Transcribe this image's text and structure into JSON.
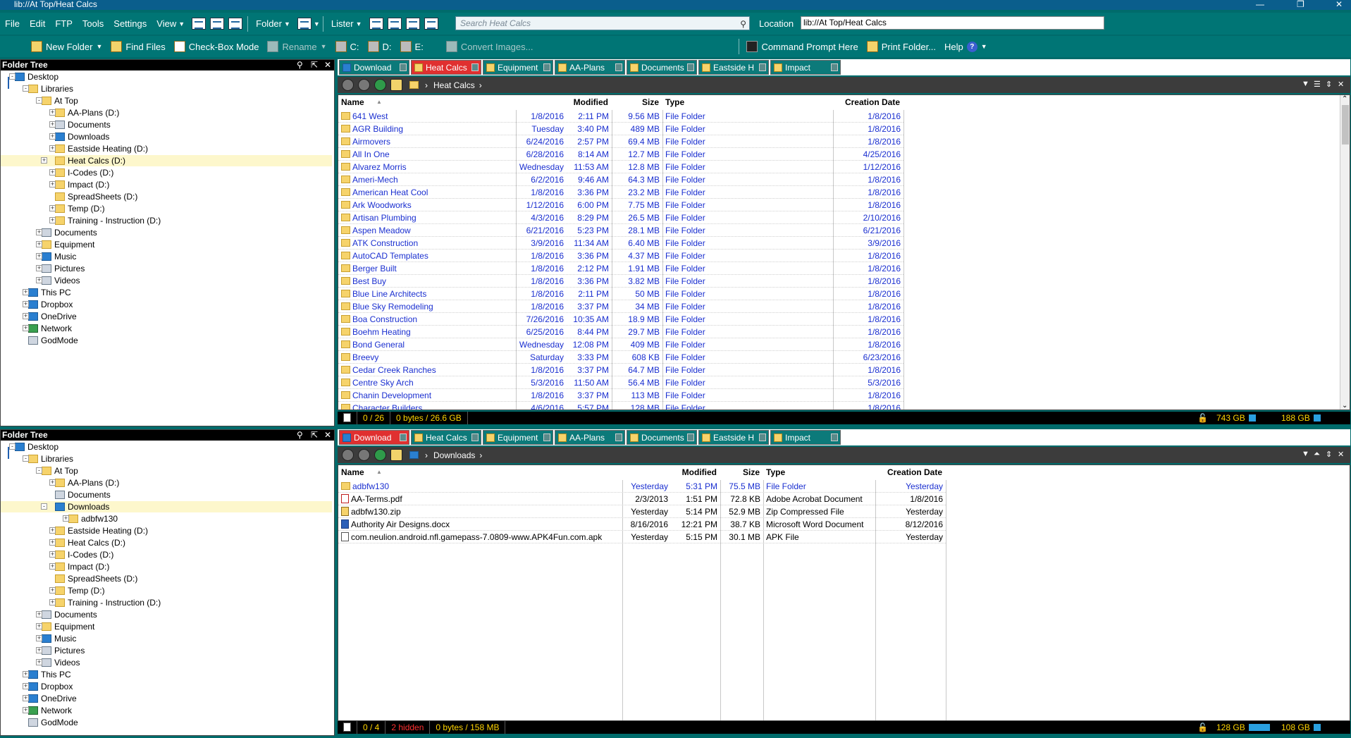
{
  "window": {
    "title": "lib://At Top/Heat Calcs"
  },
  "menu": {
    "file": "File",
    "edit": "Edit",
    "ftp": "FTP",
    "tools": "Tools",
    "settings": "Settings",
    "view": "View",
    "folder": "Folder",
    "lister": "Lister"
  },
  "search": {
    "placeholder": "Search Heat Calcs"
  },
  "location": {
    "label": "Location",
    "value": "lib://At Top/Heat Calcs"
  },
  "toolbar": {
    "new_folder": "New Folder",
    "find_files": "Find Files",
    "checkbox_mode": "Check-Box Mode",
    "rename": "Rename",
    "drive_c": "C:",
    "drive_d": "D:",
    "drive_e": "E:",
    "convert_images": "Convert Images...",
    "command_prompt": "Command Prompt Here",
    "print_folder": "Print Folder...",
    "help": "Help",
    "help_q": "?"
  },
  "top": {
    "tree": {
      "title": "Folder Tree",
      "nodes": [
        "Desktop",
        "Libraries",
        "At Top",
        "AA-Plans (D:)",
        "Documents",
        "Downloads",
        "Eastside Heating (D:)",
        "Heat Calcs (D:)",
        "I-Codes (D:)",
        "Impact (D:)",
        "SpreadSheets (D:)",
        "Temp (D:)",
        "Training - Instruction (D:)",
        "Documents",
        "Equipment",
        "Music",
        "Pictures",
        "Videos",
        "This PC",
        "Dropbox",
        "OneDrive",
        "Network",
        "GodMode"
      ]
    },
    "tabs": [
      "Download",
      "Heat Calcs",
      "Equipment",
      "AA-Plans",
      "Documents",
      "Eastside H",
      "Impact"
    ],
    "path": "Heat Calcs",
    "columns": {
      "name": "Name",
      "modified": "Modified",
      "size": "Size",
      "type": "Type",
      "created": "Creation Date"
    },
    "rows": [
      [
        "641 West",
        "1/8/2016",
        "2:11 PM",
        "9.56 MB",
        "File Folder",
        "1/8/2016"
      ],
      [
        "AGR Building",
        "Tuesday",
        "3:40 PM",
        "489 MB",
        "File Folder",
        "1/8/2016"
      ],
      [
        "Airmovers",
        "6/24/2016",
        "2:57 PM",
        "69.4 MB",
        "File Folder",
        "1/8/2016"
      ],
      [
        "All In One",
        "6/28/2016",
        "8:14 AM",
        "12.7 MB",
        "File Folder",
        "4/25/2016"
      ],
      [
        "Alvarez Morris",
        "Wednesday",
        "11:53 AM",
        "12.8 MB",
        "File Folder",
        "1/12/2016"
      ],
      [
        "Ameri-Mech",
        "6/2/2016",
        "9:46 AM",
        "64.3 MB",
        "File Folder",
        "1/8/2016"
      ],
      [
        "American Heat Cool",
        "1/8/2016",
        "3:36 PM",
        "23.2 MB",
        "File Folder",
        "1/8/2016"
      ],
      [
        "Ark Woodworks",
        "1/12/2016",
        "6:00 PM",
        "7.75 MB",
        "File Folder",
        "1/8/2016"
      ],
      [
        "Artisan Plumbing",
        "4/3/2016",
        "8:29 PM",
        "26.5 MB",
        "File Folder",
        "2/10/2016"
      ],
      [
        "Aspen Meadow",
        "6/21/2016",
        "5:23 PM",
        "28.1 MB",
        "File Folder",
        "6/21/2016"
      ],
      [
        "ATK Construction",
        "3/9/2016",
        "11:34 AM",
        "6.40 MB",
        "File Folder",
        "3/9/2016"
      ],
      [
        "AutoCAD Templates",
        "1/8/2016",
        "3:36 PM",
        "4.37 MB",
        "File Folder",
        "1/8/2016"
      ],
      [
        "Berger Built",
        "1/8/2016",
        "2:12 PM",
        "1.91 MB",
        "File Folder",
        "1/8/2016"
      ],
      [
        "Best Buy",
        "1/8/2016",
        "3:36 PM",
        "3.82 MB",
        "File Folder",
        "1/8/2016"
      ],
      [
        "Blue Line Architects",
        "1/8/2016",
        "2:11 PM",
        "50 MB",
        "File Folder",
        "1/8/2016"
      ],
      [
        "Blue Sky Remodeling",
        "1/8/2016",
        "3:37 PM",
        "34 MB",
        "File Folder",
        "1/8/2016"
      ],
      [
        "Boa Construction",
        "7/26/2016",
        "10:35 AM",
        "18.9 MB",
        "File Folder",
        "1/8/2016"
      ],
      [
        "Boehm Heating",
        "6/25/2016",
        "8:44 PM",
        "29.7 MB",
        "File Folder",
        "1/8/2016"
      ],
      [
        "Bond General",
        "Wednesday",
        "12:08 PM",
        "409 MB",
        "File Folder",
        "1/8/2016"
      ],
      [
        "Breevy",
        "Saturday",
        "3:33 PM",
        "608 KB",
        "File Folder",
        "6/23/2016"
      ],
      [
        "Cedar Creek Ranches",
        "1/8/2016",
        "3:37 PM",
        "64.7 MB",
        "File Folder",
        "1/8/2016"
      ],
      [
        "Centre Sky Arch",
        "5/3/2016",
        "11:50 AM",
        "56.4 MB",
        "File Folder",
        "5/3/2016"
      ],
      [
        "Chanin Development",
        "1/8/2016",
        "3:37 PM",
        "113 MB",
        "File Folder",
        "1/8/2016"
      ],
      [
        "Character Builders",
        "4/6/2016",
        "5:57 PM",
        "128 MB",
        "File Folder",
        "1/8/2016"
      ]
    ],
    "status": {
      "count": "0 / 26",
      "bytes": "0 bytes / 26.6 GB",
      "drive1": "743 GB",
      "drive2": "188 GB"
    }
  },
  "bottom": {
    "tree": {
      "title": "Folder Tree",
      "nodes": [
        "Desktop",
        "Libraries",
        "At Top",
        "AA-Plans (D:)",
        "Documents",
        "Downloads",
        "adbfw130",
        "Eastside Heating (D:)",
        "Heat Calcs (D:)",
        "I-Codes (D:)",
        "Impact (D:)",
        "SpreadSheets (D:)",
        "Temp (D:)",
        "Training - Instruction (D:)",
        "Documents",
        "Equipment",
        "Music",
        "Pictures",
        "Videos",
        "This PC",
        "Dropbox",
        "OneDrive",
        "Network",
        "GodMode"
      ]
    },
    "tabs": [
      "Download",
      "Heat Calcs",
      "Equipment",
      "AA-Plans",
      "Documents",
      "Eastside H",
      "Impact"
    ],
    "path": "Downloads",
    "columns": {
      "name": "Name",
      "modified": "Modified",
      "size": "Size",
      "type": "Type",
      "created": "Creation Date"
    },
    "rows": [
      [
        "adbfw130",
        "Yesterday",
        "5:31 PM",
        "75.5 MB",
        "File Folder",
        "Yesterday"
      ],
      [
        "AA-Terms.pdf",
        "2/3/2013",
        "1:51 PM",
        "72.8 KB",
        "Adobe Acrobat Document",
        "1/8/2016"
      ],
      [
        "adbfw130.zip",
        "Yesterday",
        "5:14 PM",
        "52.9 MB",
        "Zip Compressed File",
        "Yesterday"
      ],
      [
        "Authority Air Designs.docx",
        "8/16/2016",
        "12:21 PM",
        "38.7 KB",
        "Microsoft Word Document",
        "8/12/2016"
      ],
      [
        "com.neulion.android.nfl.gamepass-7.0809-www.APK4Fun.com.apk",
        "Yesterday",
        "5:15 PM",
        "30.1 MB",
        "APK File",
        "Yesterday"
      ]
    ],
    "row_icons": [
      "folder",
      "pdf",
      "zip",
      "doc",
      "file"
    ],
    "status": {
      "count": "0 / 4",
      "hidden": "2 hidden",
      "bytes": "0 bytes / 158 MB",
      "drive1": "128 GB",
      "drive2": "108 GB"
    }
  }
}
